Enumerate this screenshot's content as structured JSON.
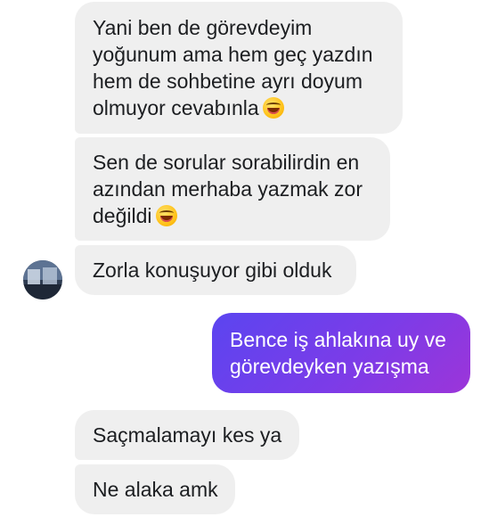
{
  "messages": {
    "incoming_1": {
      "line_1": "Yani ben de görevdeyim",
      "line_2": "yoğunum ama hem geç yazdın",
      "line_3": "hem de sohbetine ayrı doyum",
      "line_4": "olmuyor cevabınla",
      "emoji": "laughing-emoji"
    },
    "incoming_2": {
      "line_1": "Sen de sorular sorabilirdin en",
      "line_2": "azından merhaba yazmak zor",
      "line_3": "değildi",
      "emoji": "laughing-emoji"
    },
    "incoming_3": {
      "text": "Zorla konuşuyor gibi olduk"
    },
    "outgoing_1": {
      "line_1": "Bence iş ahlakına uy ve",
      "line_2": "görevdeyken yazışma"
    },
    "incoming_4": {
      "text": "Saçmalamayı kes ya"
    },
    "incoming_5": {
      "text": "Ne alaka amk"
    }
  },
  "colors": {
    "incoming_bubble": "#efefef",
    "incoming_text": "#1c1e21",
    "outgoing_gradient_start": "#5b45f0",
    "outgoing_gradient_end": "#9c35d9",
    "outgoing_text": "#ffffff"
  }
}
